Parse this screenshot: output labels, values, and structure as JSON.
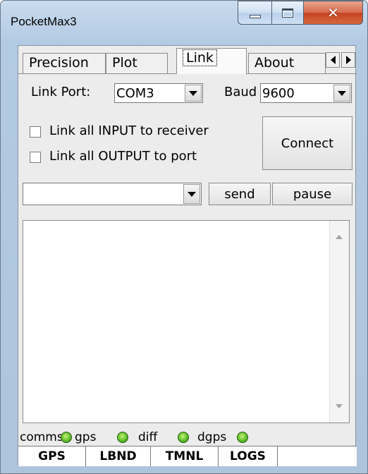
{
  "window": {
    "title": "PocketMax3"
  },
  "tabs": [
    {
      "label": "Precision"
    },
    {
      "label": "Plot"
    },
    {
      "label": "Link"
    },
    {
      "label": "About"
    }
  ],
  "link": {
    "port_label": "Link Port:",
    "port_value": "COM3",
    "baud_label": "Baud",
    "baud_value": "9600",
    "check_input": "Link all INPUT to receiver",
    "check_output": "Link all OUTPUT to port",
    "connect": "Connect",
    "command_value": "",
    "send": "send",
    "pause": "pause"
  },
  "indicators": [
    {
      "label": "comms",
      "color": "#5fbf2a"
    },
    {
      "label": "gps",
      "color": "#5fbf2a"
    },
    {
      "label": "diff",
      "color": "#5fbf2a"
    },
    {
      "label": "dgps",
      "color": "#5fbf2a"
    }
  ],
  "bottom_tabs": [
    {
      "label": "GPS"
    },
    {
      "label": "LBND"
    },
    {
      "label": "TMNL"
    },
    {
      "label": "LOGS"
    },
    {
      "label": ""
    }
  ],
  "icons": {
    "minimize": "minimize-icon",
    "maximize": "maximize-icon",
    "close": "close-icon",
    "dropdown": "chevron-down-icon",
    "scroll_left": "arrow-left-icon",
    "scroll_right": "arrow-right-icon"
  }
}
